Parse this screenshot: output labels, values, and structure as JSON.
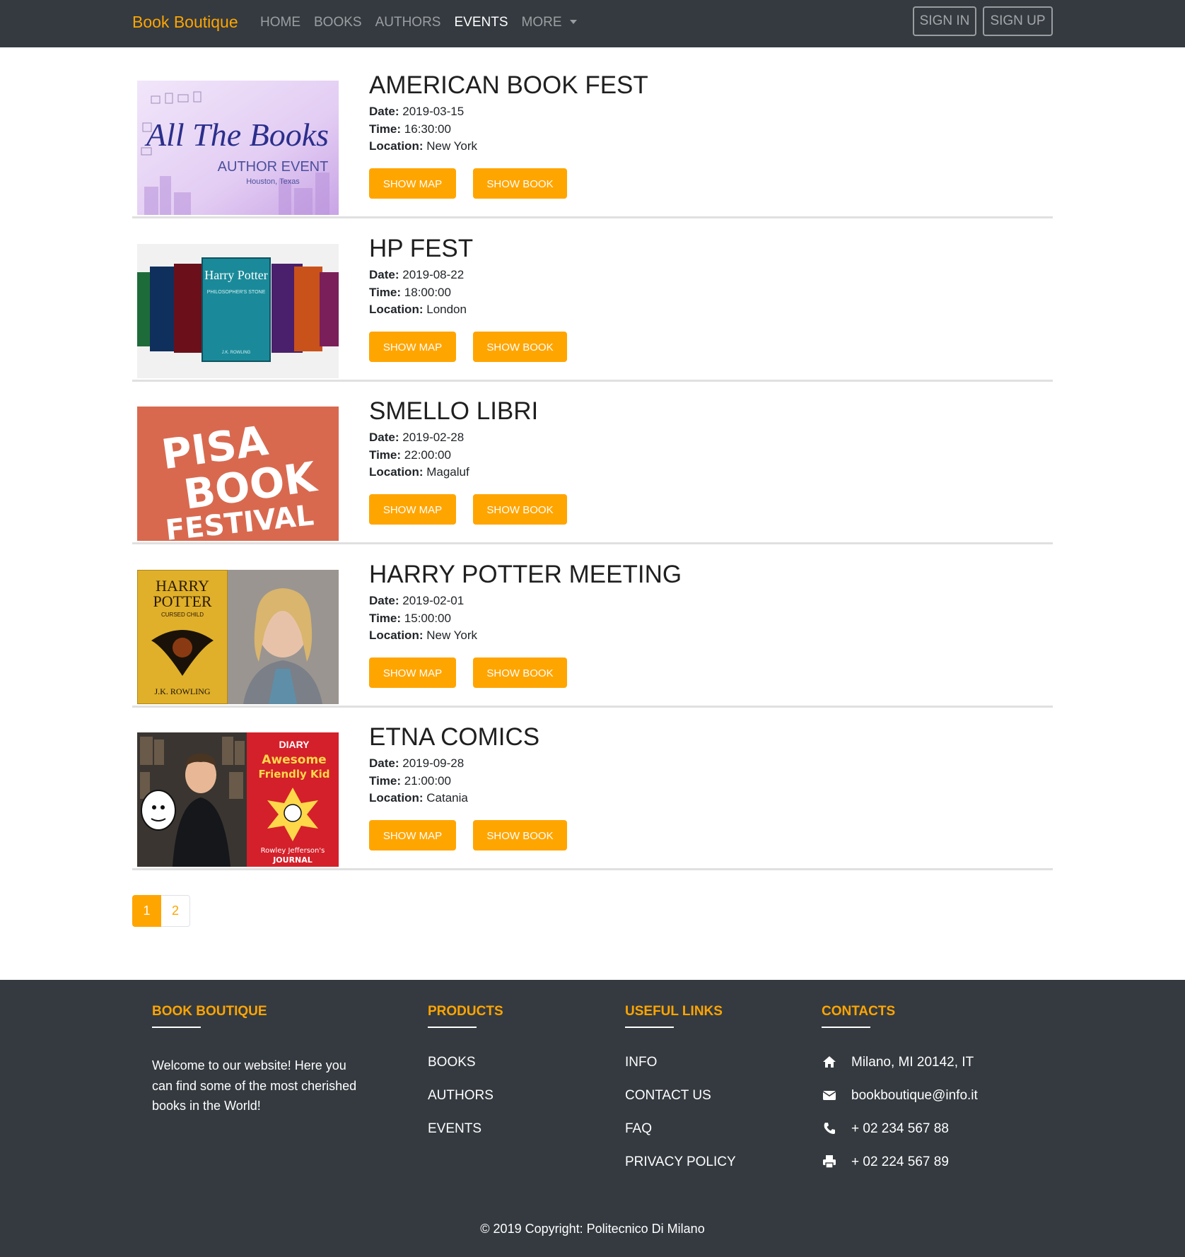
{
  "navbar": {
    "brand": "Book Boutique",
    "links": [
      "HOME",
      "BOOKS",
      "AUTHORS",
      "EVENTS",
      "MORE"
    ],
    "active_link": "EVENTS",
    "sign_in": "SIGN IN",
    "sign_up": "SIGN UP"
  },
  "labels": {
    "date": "Date:",
    "time": "Time:",
    "location": "Location:",
    "show_map": "SHOW MAP",
    "show_book": "SHOW BOOK"
  },
  "events": [
    {
      "title": "AMERICAN BOOK FEST",
      "date": "2019-03-15",
      "time": "16:30:00",
      "location": "New York",
      "image_text": [
        "All The Books",
        "AUTHOR EVENT",
        "Houston, Texas"
      ]
    },
    {
      "title": "HP FEST",
      "date": "2019-08-22",
      "time": "18:00:00",
      "location": "London",
      "image_text": [
        "Harry Potter",
        "PHILOSOPHER'S STONE",
        "J.K. ROWLING"
      ]
    },
    {
      "title": "SMELLO LIBRI",
      "date": "2019-02-28",
      "time": "22:00:00",
      "location": "Magaluf",
      "image_text": [
        "PISA",
        "BOOK",
        "FESTIVAL"
      ]
    },
    {
      "title": "HARRY POTTER MEETING",
      "date": "2019-02-01",
      "time": "15:00:00",
      "location": "New York",
      "image_text": [
        "HARRY",
        "POTTER",
        "CURSED CHILD",
        "J.K. ROWLING"
      ]
    },
    {
      "title": "ETNA COMICS",
      "date": "2019-09-28",
      "time": "21:00:00",
      "location": "Catania",
      "image_text": [
        "DIARY",
        "Awesome",
        "Friendly Kid",
        "Rowley Jefferson's",
        "JOURNAL"
      ]
    }
  ],
  "pagination": {
    "pages": [
      "1",
      "2"
    ],
    "current": "1"
  },
  "footer": {
    "about": {
      "title": "BOOK BOUTIQUE",
      "text": "Welcome to our website! Here you can find some of the most cherished books in the World!"
    },
    "products": {
      "title": "PRODUCTS",
      "links": [
        "BOOKS",
        "AUTHORS",
        "EVENTS"
      ]
    },
    "useful_links": {
      "title": "USEFUL LINKS",
      "links": [
        "INFO",
        "CONTACT US",
        "FAQ",
        "PRIVACY POLICY"
      ]
    },
    "contacts": {
      "title": "CONTACTS",
      "items": [
        {
          "icon": "home-icon",
          "text": "Milano, MI 20142, IT"
        },
        {
          "icon": "envelope-icon",
          "text": "bookboutique@info.it"
        },
        {
          "icon": "phone-icon",
          "text": "+ 02 234 567 88"
        },
        {
          "icon": "print-icon",
          "text": "+ 02 224 567 89"
        }
      ]
    },
    "copyright": "© 2019 Copyright: Politecnico Di Milano"
  },
  "colors": {
    "accent": "#ffa500",
    "navbar_bg": "#343a40",
    "footer_bg": "#343a40"
  }
}
